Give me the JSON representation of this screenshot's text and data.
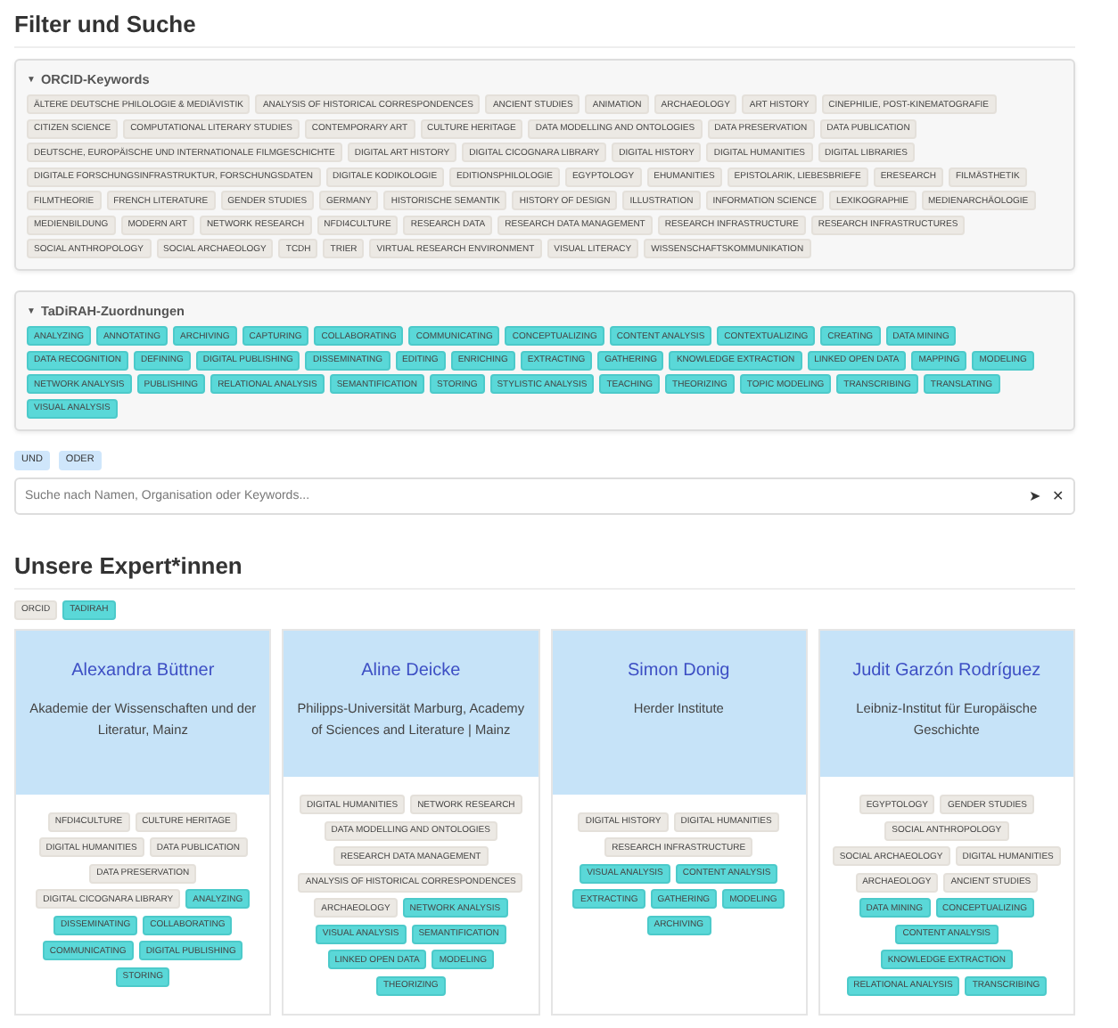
{
  "filter_title": "Filter und Suche",
  "panels": [
    {
      "title": "ORCID-Keywords",
      "toggle_icon": "▼",
      "expanded": true,
      "kind": "orcid",
      "tags": [
        "ÄLTERE DEUTSCHE PHILOLOGIE & MEDIÄVISTIK",
        "ANALYSIS OF HISTORICAL CORRESPONDENCES",
        "ANCIENT STUDIES",
        "ANIMATION",
        "ARCHAEOLOGY",
        "ART HISTORY",
        "CINEPHILIE, POST-KINEMATOGRAFIE",
        "CITIZEN SCIENCE",
        "COMPUTATIONAL LITERARY STUDIES",
        "CONTEMPORARY ART",
        "CULTURE HERITAGE",
        "DATA MODELLING AND ONTOLOGIES",
        "DATA PRESERVATION",
        "DATA PUBLICATION",
        "DEUTSCHE, EUROPÄISCHE UND INTERNATIONALE FILMGESCHICHTE",
        "DIGITAL ART HISTORY",
        "DIGITAL CICOGNARA LIBRARY",
        "DIGITAL HISTORY",
        "DIGITAL HUMANITIES",
        "DIGITAL LIBRARIES",
        "DIGITALE FORSCHUNGSINFRASTRUKTUR, FORSCHUNGSDATEN",
        "DIGITALE KODIKOLOGIE",
        "EDITIONSPHILOLOGIE",
        "EGYPTOLOGY",
        "EHUMANITIES",
        "EPISTOLARIK, LIEBESBRIEFE",
        "ERESEARCH",
        "FILMÄSTHETIK",
        "FILMTHEORIE",
        "FRENCH LITERATURE",
        "GENDER STUDIES",
        "GERMANY",
        "HISTORISCHE SEMANTIK",
        "HISTORY OF DESIGN",
        "ILLUSTRATION",
        "INFORMATION SCIENCE",
        "LEXIKOGRAPHIE",
        "MEDIENARCHÄOLOGIE",
        "MEDIENBILDUNG",
        "MODERN ART",
        "NETWORK RESEARCH",
        "NFDI4CULTURE",
        "RESEARCH DATA",
        "RESEARCH DATA MANAGEMENT",
        "RESEARCH INFRASTRUCTURE",
        "RESEARCH INFRASTRUCTURES",
        "SOCIAL ANTHROPOLOGY",
        "SOCIAL ARCHAEOLOGY",
        "TCDH",
        "TRIER",
        "VIRTUAL RESEARCH ENVIRONMENT",
        "VISUAL LITERACY",
        "WISSENSCHAFTSKOMMUNIKATION"
      ]
    },
    {
      "title": "TaDiRAH-Zuordnungen",
      "toggle_icon": "▼",
      "expanded": true,
      "kind": "tadirah",
      "tags": [
        "ANALYZING",
        "ANNOTATING",
        "ARCHIVING",
        "CAPTURING",
        "COLLABORATING",
        "COMMUNICATING",
        "CONCEPTUALIZING",
        "CONTENT ANALYSIS",
        "CONTEXTUALIZING",
        "CREATING",
        "DATA MINING",
        "DATA RECOGNITION",
        "DEFINING",
        "DIGITAL PUBLISHING",
        "DISSEMINATING",
        "EDITING",
        "ENRICHING",
        "EXTRACTING",
        "GATHERING",
        "KNOWLEDGE EXTRACTION",
        "LINKED OPEN DATA",
        "MAPPING",
        "MODELING",
        "NETWORK ANALYSIS",
        "PUBLISHING",
        "RELATIONAL ANALYSIS",
        "SEMANTIFICATION",
        "STORING",
        "STYLISTIC ANALYSIS",
        "TEACHING",
        "THEORIZING",
        "TOPIC MODELING",
        "TRANSCRIBING",
        "TRANSLATING",
        "VISUAL ANALYSIS"
      ]
    }
  ],
  "operators": [
    "UND",
    "ODER"
  ],
  "search": {
    "placeholder": "Suche nach Namen, Organisation oder Keywords...",
    "submit_icon": "➤",
    "clear_icon": "✕"
  },
  "experts_title": "Unsere Expert*innen",
  "legend": [
    {
      "label": "ORCID",
      "kind": "orcid"
    },
    {
      "label": "TADIRAH",
      "kind": "tadirah"
    }
  ],
  "experts": [
    {
      "name": "Alexandra Büttner",
      "organization": "Akademie der Wissenschaften und der Literatur, Mainz",
      "tags": [
        {
          "label": "NFDI4CULTURE",
          "kind": "orcid"
        },
        {
          "label": "CULTURE HERITAGE",
          "kind": "orcid"
        },
        {
          "label": "DIGITAL HUMANITIES",
          "kind": "orcid"
        },
        {
          "label": "DATA PUBLICATION",
          "kind": "orcid"
        },
        {
          "label": "DATA PRESERVATION",
          "kind": "orcid"
        },
        {
          "label": "DIGITAL CICOGNARA LIBRARY",
          "kind": "orcid"
        },
        {
          "label": "ANALYZING",
          "kind": "tadirah"
        },
        {
          "label": "DISSEMINATING",
          "kind": "tadirah"
        },
        {
          "label": "COLLABORATING",
          "kind": "tadirah"
        },
        {
          "label": "COMMUNICATING",
          "kind": "tadirah"
        },
        {
          "label": "DIGITAL PUBLISHING",
          "kind": "tadirah"
        },
        {
          "label": "STORING",
          "kind": "tadirah"
        }
      ]
    },
    {
      "name": "Aline Deicke",
      "organization": "Philipps-Universität Marburg, Academy of Sciences and Literature | Mainz",
      "tags": [
        {
          "label": "DIGITAL HUMANITIES",
          "kind": "orcid"
        },
        {
          "label": "NETWORK RESEARCH",
          "kind": "orcid"
        },
        {
          "label": "DATA MODELLING AND ONTOLOGIES",
          "kind": "orcid"
        },
        {
          "label": "RESEARCH DATA MANAGEMENT",
          "kind": "orcid"
        },
        {
          "label": "ANALYSIS OF HISTORICAL CORRESPONDENCES",
          "kind": "orcid"
        },
        {
          "label": "ARCHAEOLOGY",
          "kind": "orcid"
        },
        {
          "label": "NETWORK ANALYSIS",
          "kind": "tadirah"
        },
        {
          "label": "VISUAL ANALYSIS",
          "kind": "tadirah"
        },
        {
          "label": "SEMANTIFICATION",
          "kind": "tadirah"
        },
        {
          "label": "LINKED OPEN DATA",
          "kind": "tadirah"
        },
        {
          "label": "MODELING",
          "kind": "tadirah"
        },
        {
          "label": "THEORIZING",
          "kind": "tadirah"
        }
      ]
    },
    {
      "name": "Simon Donig",
      "organization": "Herder Institute",
      "tags": [
        {
          "label": "DIGITAL HISTORY",
          "kind": "orcid"
        },
        {
          "label": "DIGITAL HUMANITIES",
          "kind": "orcid"
        },
        {
          "label": "RESEARCH INFRASTRUCTURE",
          "kind": "orcid"
        },
        {
          "label": "VISUAL ANALYSIS",
          "kind": "tadirah"
        },
        {
          "label": "CONTENT ANALYSIS",
          "kind": "tadirah"
        },
        {
          "label": "EXTRACTING",
          "kind": "tadirah"
        },
        {
          "label": "GATHERING",
          "kind": "tadirah"
        },
        {
          "label": "MODELING",
          "kind": "tadirah"
        },
        {
          "label": "ARCHIVING",
          "kind": "tadirah"
        }
      ]
    },
    {
      "name": "Judit Garzón Rodríguez",
      "organization": "Leibniz-Institut für Europäische Geschichte",
      "tags": [
        {
          "label": "EGYPTOLOGY",
          "kind": "orcid"
        },
        {
          "label": "GENDER STUDIES",
          "kind": "orcid"
        },
        {
          "label": "SOCIAL ANTHROPOLOGY",
          "kind": "orcid"
        },
        {
          "label": "SOCIAL ARCHAEOLOGY",
          "kind": "orcid"
        },
        {
          "label": "DIGITAL HUMANITIES",
          "kind": "orcid"
        },
        {
          "label": "ARCHAEOLOGY",
          "kind": "orcid"
        },
        {
          "label": "ANCIENT STUDIES",
          "kind": "orcid"
        },
        {
          "label": "DATA MINING",
          "kind": "tadirah"
        },
        {
          "label": "CONCEPTUALIZING",
          "kind": "tadirah"
        },
        {
          "label": "CONTENT ANALYSIS",
          "kind": "tadirah"
        },
        {
          "label": "KNOWLEDGE EXTRACTION",
          "kind": "tadirah"
        },
        {
          "label": "RELATIONAL ANALYSIS",
          "kind": "tadirah"
        },
        {
          "label": "TRANSCRIBING",
          "kind": "tadirah"
        }
      ]
    }
  ]
}
